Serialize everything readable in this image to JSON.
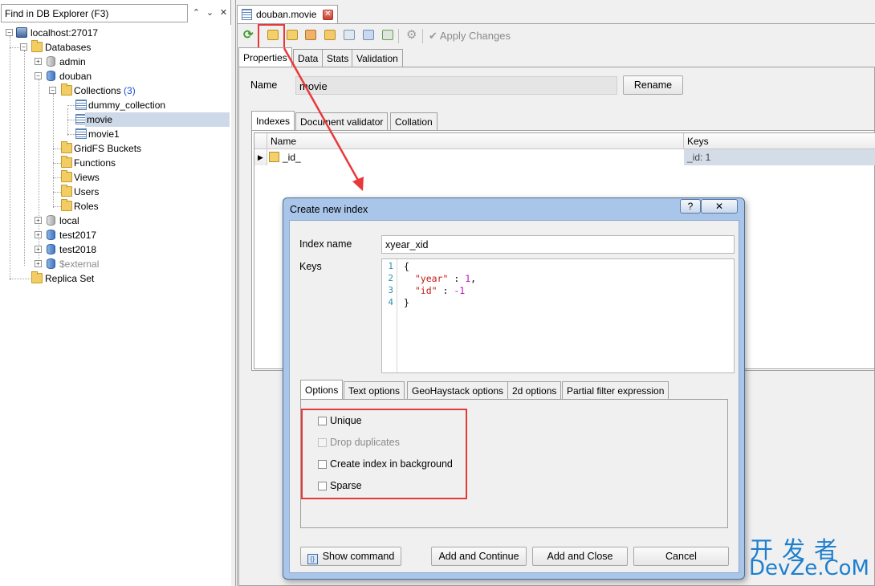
{
  "explorer": {
    "find_placeholder": "Find in DB Explorer (F3)",
    "tree": {
      "server": "localhost:27017",
      "databases_label": "Databases",
      "db_admin": "admin",
      "db_douban": "douban",
      "collections_label": "Collections",
      "collections_count": "(3)",
      "col_dummy": "dummy_collection",
      "col_movie": "movie",
      "col_movie1": "movie1",
      "gridfs": "GridFS Buckets",
      "functions": "Functions",
      "views": "Views",
      "users": "Users",
      "roles": "Roles",
      "db_local": "local",
      "db_test2017": "test2017",
      "db_test2018": "test2018",
      "db_external": "$external",
      "replica_set": "Replica Set"
    }
  },
  "document_tab": {
    "title": "douban.movie"
  },
  "toolbar": {
    "apply_label": "Apply Changes"
  },
  "main_tabs": [
    "Properties",
    "Data",
    "Stats",
    "Validation"
  ],
  "properties": {
    "name_label": "Name",
    "name_value": "movie",
    "rename_label": "Rename"
  },
  "sub_tabs": [
    "Indexes",
    "Document validator",
    "Collation"
  ],
  "indexes_grid": {
    "columns": [
      "Name",
      "Keys"
    ],
    "rows": [
      {
        "name": "_id_",
        "keys": "_id: 1"
      }
    ]
  },
  "dialog": {
    "title": "Create new index",
    "help": "?",
    "close": "✕",
    "index_name_label": "Index name",
    "index_name_value": "xyear_xid",
    "keys_label": "Keys",
    "keys_lines": [
      "1",
      "2",
      "3",
      "4"
    ],
    "keys_code": {
      "open": "{",
      "year_key": "\"year\"",
      "year_val": "1",
      "id_key": "\"id\"",
      "id_val": "-1",
      "close": "}"
    },
    "option_tabs": [
      "Options",
      "Text options",
      "GeoHaystack options",
      "2d options",
      "Partial filter expression"
    ],
    "options": [
      {
        "label": "Unique",
        "checked": false,
        "enabled": true
      },
      {
        "label": "Drop duplicates",
        "checked": false,
        "enabled": false
      },
      {
        "label": "Create index in background",
        "checked": false,
        "enabled": true
      },
      {
        "label": "Sparse",
        "checked": false,
        "enabled": true
      }
    ],
    "show_command_label": "Show command",
    "add_continue_label": "Add and Continue",
    "add_close_label": "Add and Close",
    "cancel_label": "Cancel"
  },
  "watermark": {
    "cn": "开发者",
    "en": "DevZe.CoM"
  },
  "colors": {
    "highlight_red": "#e8393a",
    "selection": "#cdd9e8",
    "dialog_frame": "#a9c6ea",
    "watermark": "#1e7fcf"
  }
}
